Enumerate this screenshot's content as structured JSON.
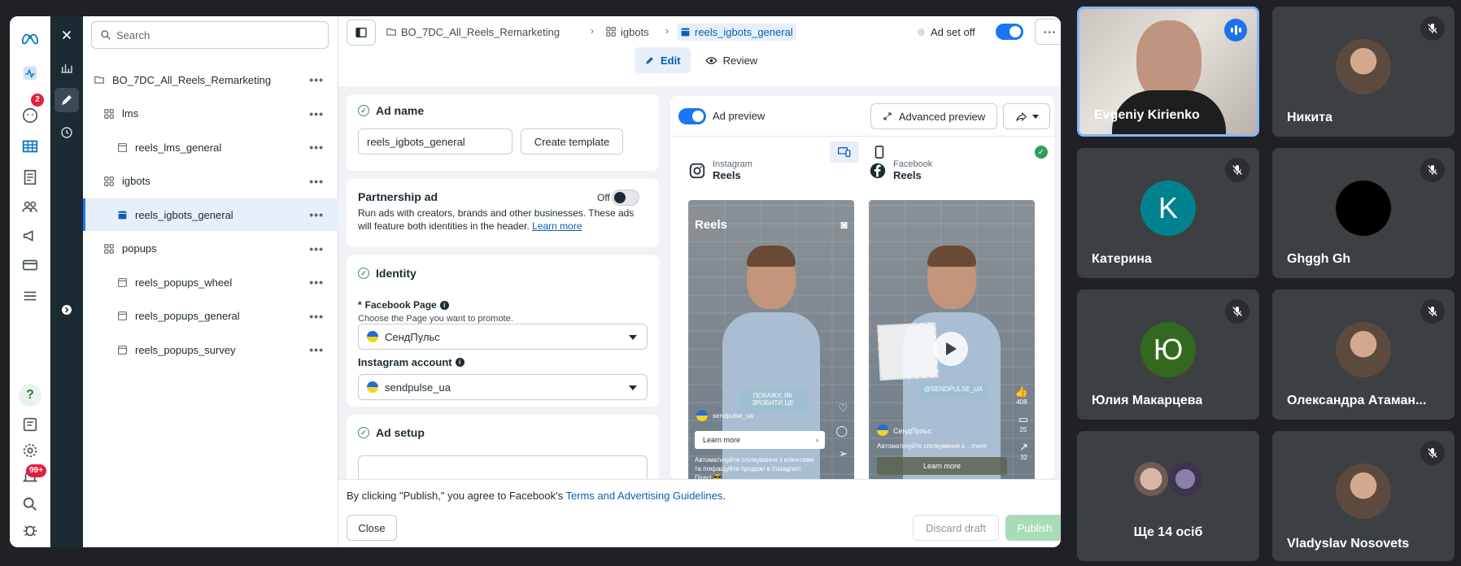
{
  "sidebar": {
    "notif_count": "2",
    "alert_count": "99+"
  },
  "tree": {
    "search_placeholder": "Search",
    "items": [
      {
        "label": "BO_7DC_All_Reels_Remarketing",
        "type": "campaign"
      },
      {
        "label": "lms",
        "type": "adset"
      },
      {
        "label": "reels_lms_general",
        "type": "ad"
      },
      {
        "label": "igbots",
        "type": "adset"
      },
      {
        "label": "reels_igbots_general",
        "type": "ad",
        "selected": true
      },
      {
        "label": "popups",
        "type": "adset"
      },
      {
        "label": "reels_popups_wheel",
        "type": "ad"
      },
      {
        "label": "reels_popups_general",
        "type": "ad"
      },
      {
        "label": "reels_popups_survey",
        "type": "ad"
      }
    ]
  },
  "topbar": {
    "breadcrumb": [
      "BO_7DC_All_Reels_Remarketing",
      "igbots",
      "reels_igbots_general"
    ],
    "adset_status": "Ad set off",
    "edit_label": "Edit",
    "review_label": "Review"
  },
  "ad_name": {
    "title": "Ad name",
    "value": "reels_igbots_general",
    "create_template": "Create template"
  },
  "partnership": {
    "title": "Partnership ad",
    "toggle_label": "Off",
    "description": "Run ads with creators, brands and other businesses. These ads will feature both identities in the header.",
    "learn_more": "Learn more"
  },
  "identity": {
    "title": "Identity",
    "fb_page_label": "Facebook Page",
    "fb_page_help": "Choose the Page you want to promote.",
    "fb_page_value": "СендПульс",
    "ig_label": "Instagram account",
    "ig_value": "sendpulse_ua"
  },
  "ad_setup": {
    "title": "Ad setup"
  },
  "preview": {
    "toggle_label": "Ad preview",
    "advanced": "Advanced preview",
    "instagram": {
      "platform": "Instagram",
      "placement": "Reels",
      "reels_title": "Reels",
      "overlay": "ПОКАЖУ, ЯК ЗРОБИТИ ЦЕ",
      "handle": "sendpulse_ua",
      "learn_more": "Learn more",
      "caption": "Автоматизуйте спілкування з клієнтами та покращуйте продажі в Instagram Direct 😎"
    },
    "facebook": {
      "platform": "Facebook",
      "placement": "Reels",
      "overlay": "@SENDPULSE_UA",
      "page": "СендПульс",
      "caption": "Автоматизуйте спілкування з ...more",
      "learn_more": "Learn more",
      "likes": "408",
      "comments": "25",
      "shares": "32"
    }
  },
  "footer": {
    "text_prefix": "By clicking \"Publish,\" you agree to Facebook's ",
    "terms_link": "Terms and Advertising Guidelines",
    "text_suffix": ".",
    "close": "Close",
    "discard": "Discard draft",
    "publish": "Publish"
  },
  "meet": {
    "tiles": [
      {
        "name": "Evgeniy Kirienko",
        "kind": "video",
        "speaking": true
      },
      {
        "name": "Никита",
        "kind": "photo",
        "muted": true
      },
      {
        "name": "Катерина",
        "kind": "letter",
        "letter": "K",
        "color": "#00838f",
        "muted": true
      },
      {
        "name": "Ghggh Gh",
        "kind": "letter",
        "letter": "",
        "color": "#000000",
        "muted": true
      },
      {
        "name": "Юлия Макарцева",
        "kind": "letter",
        "letter": "Ю",
        "color": "#33691e",
        "muted": true
      },
      {
        "name": "Олександра Атаман...",
        "kind": "photo",
        "muted": true
      },
      {
        "name": "Ще 14 осіб",
        "kind": "group"
      },
      {
        "name": "Vladyslav Nosovets",
        "kind": "photo",
        "muted": true
      }
    ]
  }
}
